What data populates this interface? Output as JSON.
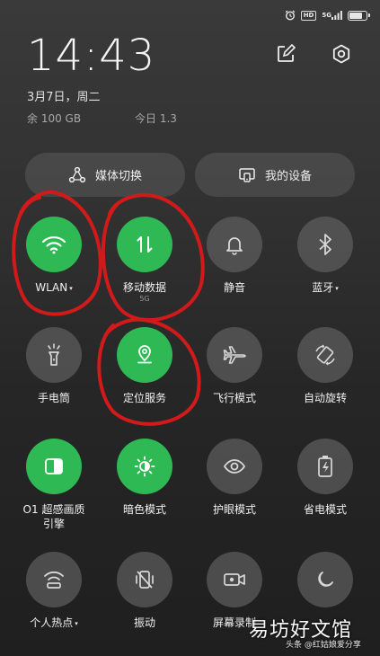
{
  "status_bar": {
    "signal_label": "5G",
    "hd_label": "HD"
  },
  "header": {
    "time": "14:43",
    "date": "3月7日，周二",
    "storage": "余 100 GB",
    "today": "今日 1.3"
  },
  "pills": {
    "media": "媒体切换",
    "devices": "我的设备"
  },
  "tiles": {
    "wlan": {
      "label": "WLAN",
      "caret": "▾"
    },
    "mobile_data": {
      "label": "移动数据",
      "sub": "5G"
    },
    "mute": {
      "label": "静音"
    },
    "bluetooth": {
      "label": "蓝牙",
      "caret": "▾"
    },
    "flashlight": {
      "label": "手电筒"
    },
    "location": {
      "label": "定位服务"
    },
    "airplane": {
      "label": "飞行模式"
    },
    "auto_rotate": {
      "label": "自动旋转"
    },
    "o1_engine": {
      "label": "O1 超感画质",
      "label2": "引擎"
    },
    "dark_mode": {
      "label": "暗色模式"
    },
    "eye_care": {
      "label": "护眼模式"
    },
    "power_saving": {
      "label": "省电模式"
    },
    "hotspot": {
      "label": "个人热点",
      "caret": "▾"
    },
    "vibrate": {
      "label": "振动"
    },
    "screen_record": {
      "label": "屏幕录制"
    },
    "dnd": {
      "label": ""
    }
  },
  "watermark": {
    "main": "易坊好文馆",
    "sub": "头条 @红姑娘爱分享"
  },
  "colors": {
    "active": "#2fb954",
    "inactive": "#5f5f5f",
    "annotation": "#d11a1a"
  }
}
